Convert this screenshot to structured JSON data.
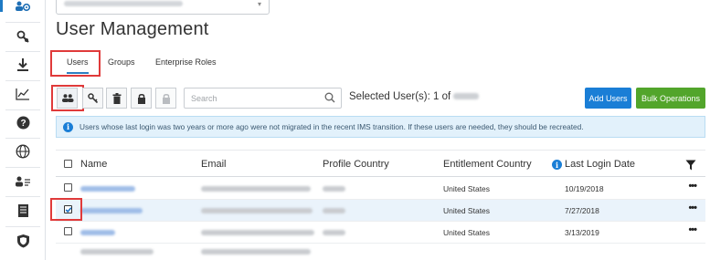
{
  "rail": {
    "items": [
      {
        "icon": "users-settings-icon",
        "active": true
      },
      {
        "icon": "key-wrench-icon"
      },
      {
        "icon": "download-icon"
      },
      {
        "icon": "line-chart-icon"
      },
      {
        "icon": "help-icon"
      },
      {
        "icon": "globe-icon"
      },
      {
        "icon": "user-list-icon"
      },
      {
        "icon": "document-icon"
      },
      {
        "icon": "shield-icon"
      }
    ]
  },
  "page": {
    "title": "User Management"
  },
  "tabs": [
    {
      "label": "Users",
      "active": true
    },
    {
      "label": "Groups"
    },
    {
      "label": "Enterprise Roles"
    }
  ],
  "toolbar": {
    "search_placeholder": "Search",
    "selected_label": "Selected User(s): 1 of",
    "add_users": "Add Users",
    "bulk_operations": "Bulk Operations"
  },
  "banner": {
    "text": "Users whose last login was two years or more ago were not migrated in the recent IMS transition. If these users are needed, they should be recreated."
  },
  "table": {
    "columns": [
      "Name",
      "Email",
      "Profile Country",
      "Entitlement Country",
      "Last Login Date"
    ],
    "rows": [
      {
        "checked": false,
        "entitlement_country": "United States",
        "last_login": "10/19/2018",
        "selected": false
      },
      {
        "checked": true,
        "entitlement_country": "United States",
        "last_login": "7/27/2018",
        "selected": true
      },
      {
        "checked": false,
        "entitlement_country": "United States",
        "last_login": "3/13/2019",
        "selected": false
      }
    ]
  },
  "colors": {
    "accent": "#1a7ed6",
    "success": "#52a52b",
    "highlight": "#e03a3a",
    "banner_bg": "#e2f1fb"
  }
}
